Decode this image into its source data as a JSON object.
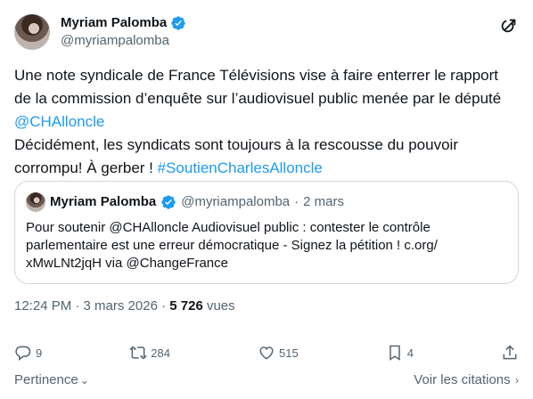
{
  "author": {
    "display_name": "Myriam Palomba",
    "handle": "@myriampalomba"
  },
  "tweet": {
    "line1": "Une note syndicale de France Télévisions vise à faire enterrer le rapport de la commission d’enquête sur l’audiovisuel public menée par le député ",
    "mention": "@CHAlloncle",
    "line2": "Décidément, les syndicats sont toujours à la rescousse du pouvoir corrompu! À gerber ! ",
    "hashtag": "#SoutienCharlesAlloncle"
  },
  "quote": {
    "display_name": "Myriam Palomba",
    "handle": "@myriampalomba",
    "separator": "·",
    "date": "2 mars",
    "body": "Pour soutenir @CHAlloncle Audiovisuel public : contester le contrôle parlementaire est une erreur démocratique - Signez la pétition ! c.org/ xMwLNt2jqH via @ChangeFrance"
  },
  "meta": {
    "time_date": "12:24 PM · 3 mars 2026 · ",
    "views_count": "5 726",
    "views_label": " vues"
  },
  "actions": {
    "replies": "9",
    "reposts": "284",
    "likes": "515",
    "bookmarks": "4"
  },
  "footer": {
    "sort_label": "Pertinence",
    "quotes_label": "Voir les citations"
  },
  "colors": {
    "link": "#1d9bf0",
    "muted": "#536471",
    "border": "#cfd9de"
  }
}
